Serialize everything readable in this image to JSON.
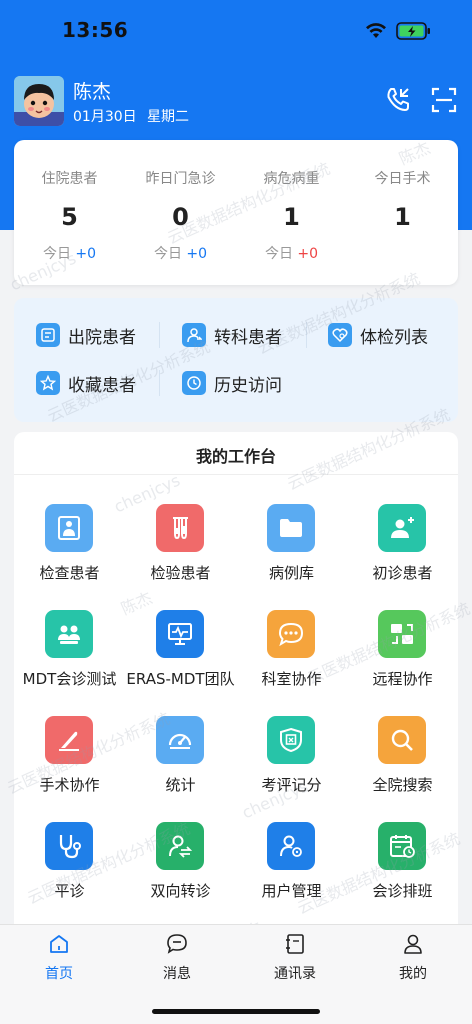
{
  "status_bar": {
    "time": "13:56"
  },
  "user": {
    "name": "陈杰",
    "date": "01月30日",
    "weekday": "星期二"
  },
  "header_icons": [
    "phone-call-icon",
    "scan-icon"
  ],
  "stats": [
    {
      "label": "住院患者",
      "value": "5",
      "today_label": "今日",
      "delta": "+0",
      "delta_color": "#1577f2"
    },
    {
      "label": "昨日门急诊",
      "value": "0",
      "today_label": "今日",
      "delta": "+0",
      "delta_color": "#1577f2"
    },
    {
      "label": "病危病重",
      "value": "1",
      "today_label": "今日",
      "delta": "+0",
      "delta_color": "#ee4444"
    },
    {
      "label": "今日手术",
      "value": "1",
      "today_label": "",
      "delta": ""
    }
  ],
  "quick_links": [
    {
      "label": "出院患者",
      "icon": "discharge-icon"
    },
    {
      "label": "转科患者",
      "icon": "transfer-icon"
    },
    {
      "label": "体检列表",
      "icon": "checkup-icon"
    },
    {
      "label": "收藏患者",
      "icon": "star-icon"
    },
    {
      "label": "历史访问",
      "icon": "history-icon"
    }
  ],
  "workbench": {
    "title": "我的工作台",
    "items": [
      {
        "label": "检查患者",
        "icon": "xray-icon",
        "color": "#5aabf2"
      },
      {
        "label": "检验患者",
        "icon": "test-tube-icon",
        "color": "#f06a6a"
      },
      {
        "label": "病例库",
        "icon": "folder-icon",
        "color": "#5aabf2"
      },
      {
        "label": "初诊患者",
        "icon": "add-user-icon",
        "color": "#27c4a8"
      },
      {
        "label": "MDT会诊测试",
        "icon": "group-icon",
        "color": "#27c4a8"
      },
      {
        "label": "ERAS-MDT团队",
        "icon": "monitor-icon",
        "color": "#1f7fe8"
      },
      {
        "label": "科室协作",
        "icon": "chat-icon",
        "color": "#f5a43c"
      },
      {
        "label": "远程协作",
        "icon": "remote-icon",
        "color": "#56c85c"
      },
      {
        "label": "手术协作",
        "icon": "scalpel-icon",
        "color": "#f06a6a"
      },
      {
        "label": "统计",
        "icon": "gauge-icon",
        "color": "#5aabf2"
      },
      {
        "label": "考评记分",
        "icon": "badge-icon",
        "color": "#27c4a8"
      },
      {
        "label": "全院搜索",
        "icon": "search-icon",
        "color": "#f5a43c"
      },
      {
        "label": "平诊",
        "icon": "stethoscope-icon",
        "color": "#1f7fe8"
      },
      {
        "label": "双向转诊",
        "icon": "referral-icon",
        "color": "#27b06a"
      },
      {
        "label": "用户管理",
        "icon": "user-settings-icon",
        "color": "#1f7fe8"
      },
      {
        "label": "会诊排班",
        "icon": "calendar-icon",
        "color": "#27b06a"
      }
    ]
  },
  "watermark": {
    "name": "陈杰",
    "account": "chenjcys",
    "system": "云医数据结构化分析系统"
  },
  "tabbar": [
    {
      "label": "首页",
      "icon": "home-icon",
      "active": true
    },
    {
      "label": "消息",
      "icon": "message-icon",
      "active": false
    },
    {
      "label": "通讯录",
      "icon": "contacts-icon",
      "active": false
    },
    {
      "label": "我的",
      "icon": "profile-icon",
      "active": false
    }
  ]
}
